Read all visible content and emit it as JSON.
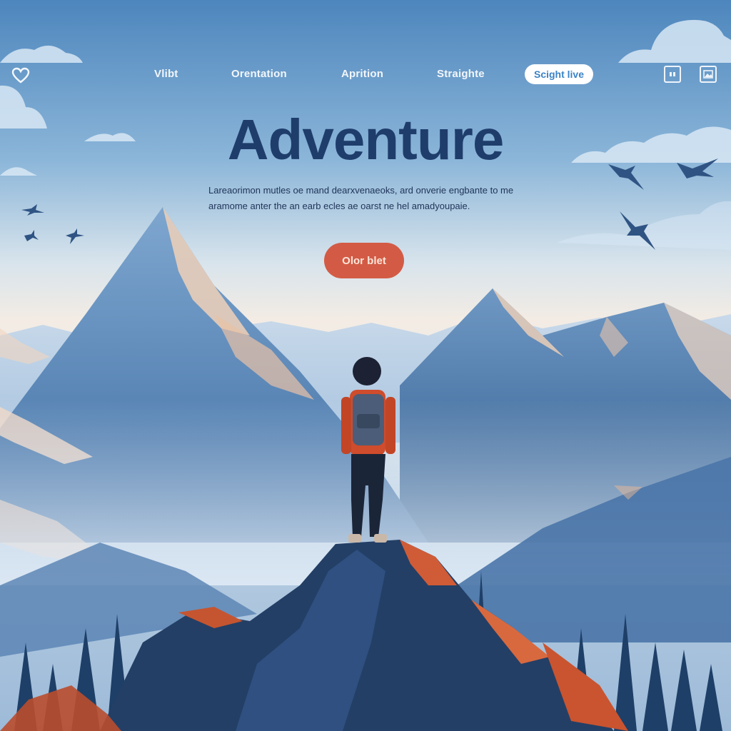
{
  "nav": {
    "links": [
      "Vlibt",
      "Orentation",
      "Aprition",
      "Straighte"
    ],
    "cta_label": "Scight live",
    "icons": [
      "heart-icon",
      "quote-icon",
      "image-icon"
    ]
  },
  "hero": {
    "title": "Adventure",
    "description": "Lareaorimon mutles oe mand dearxvenaeoks, ard onverie engbante to me aramome anter the an earb ecles ae oarst ne hel amadyoupaie.",
    "cta_label": "Olor blet"
  },
  "colors": {
    "title": "#1f3d6b",
    "cta_background": "#d35b45",
    "nav_cta_text": "#3b83c6",
    "sky_top": "#4d86bd"
  }
}
